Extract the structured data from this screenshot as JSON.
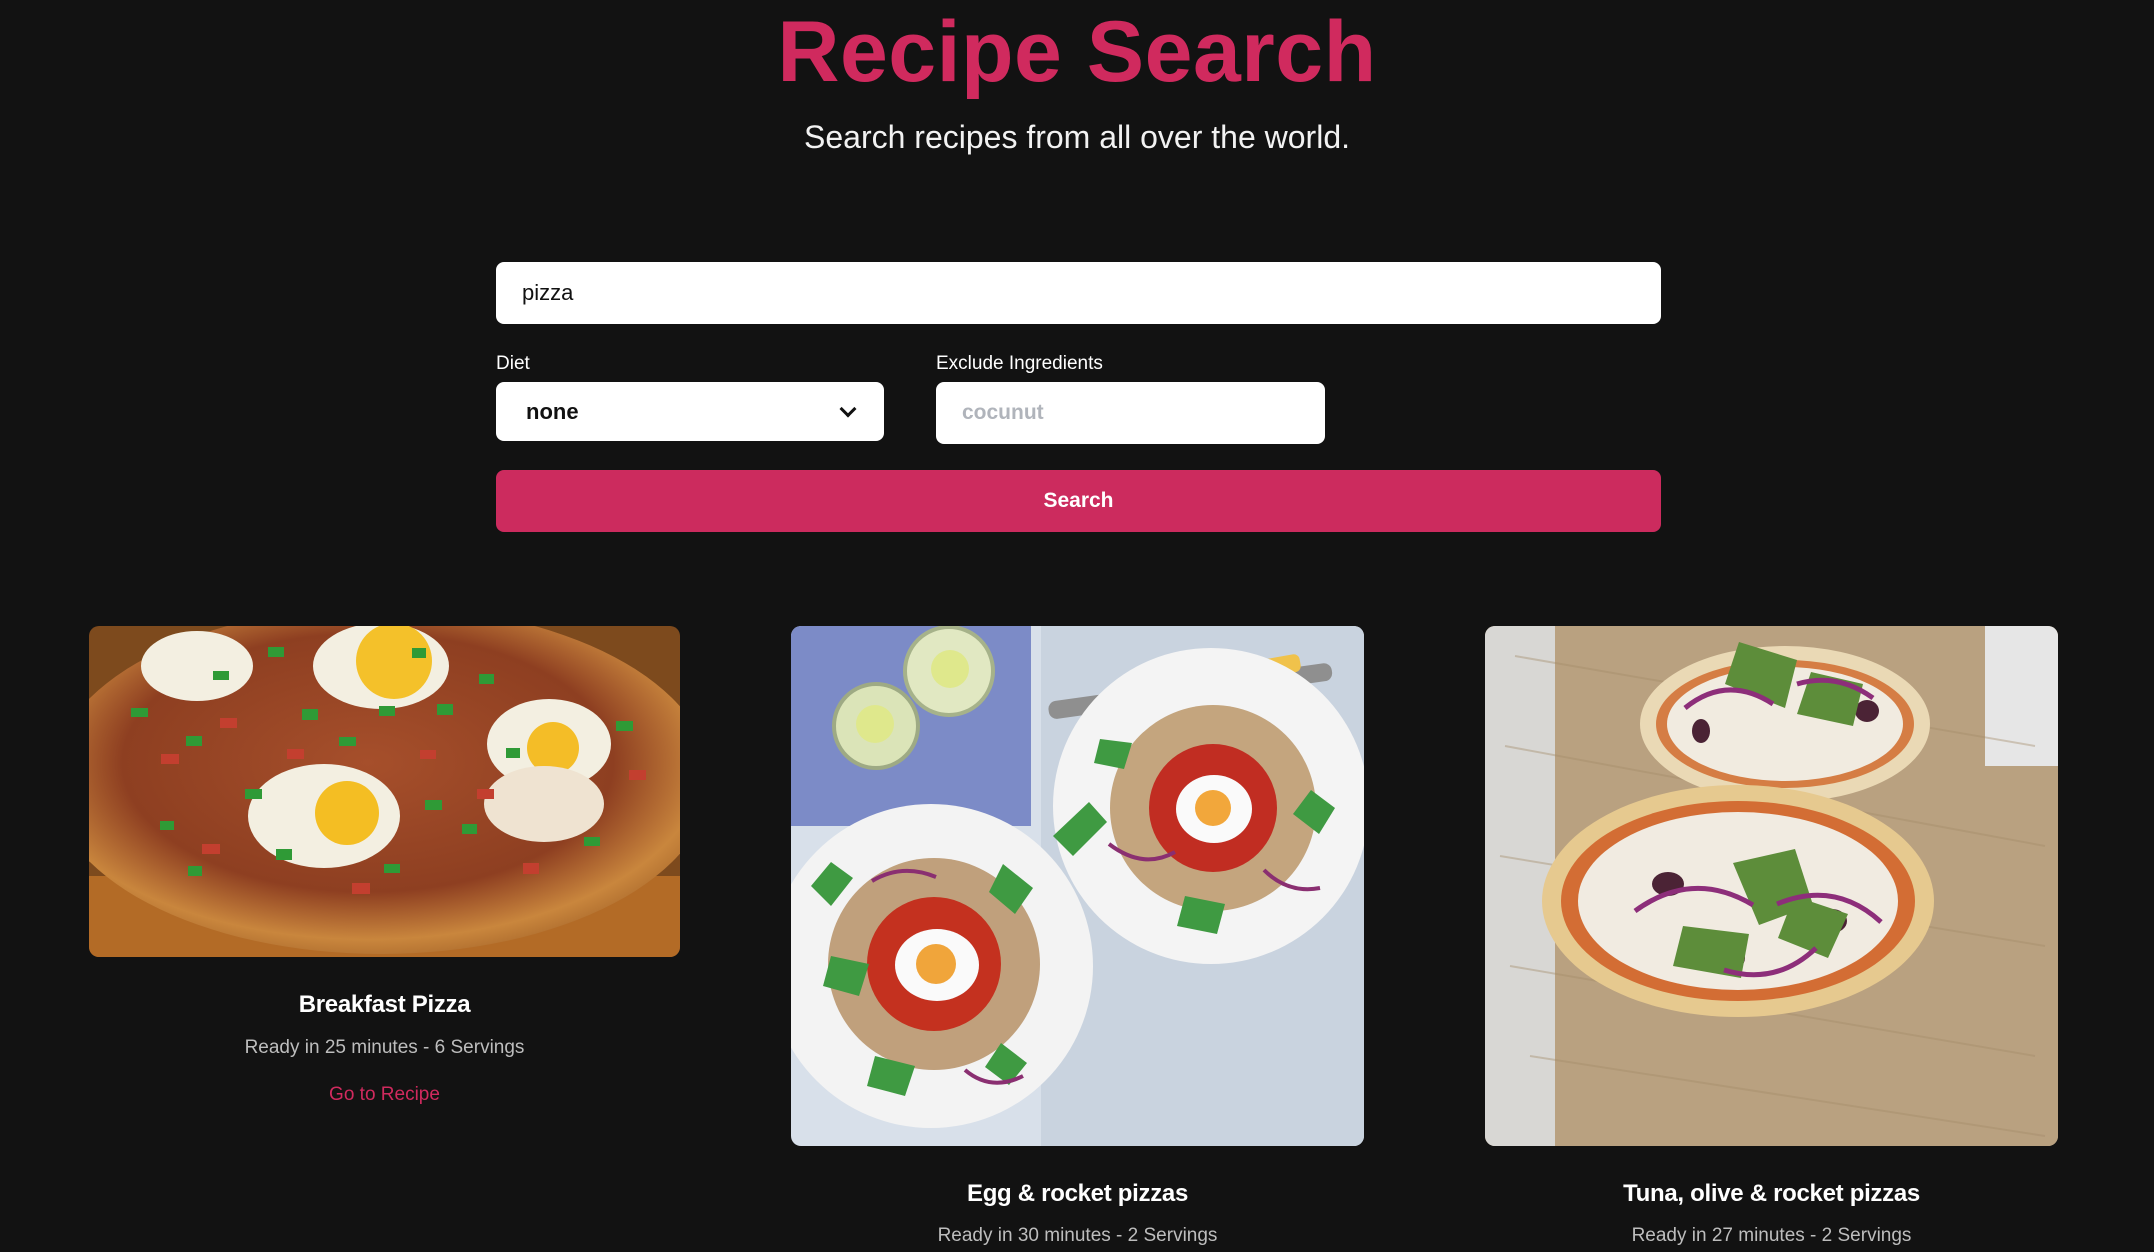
{
  "header": {
    "title": "Recipe Search",
    "subtitle": "Search recipes from all over the world."
  },
  "search": {
    "query_value": "pizza",
    "diet_label": "Diet",
    "diet_selected": "none",
    "exclude_label": "Exclude Ingredients",
    "exclude_placeholder": "cocunut",
    "button_label": "Search"
  },
  "recipes": [
    {
      "title": "Breakfast Pizza",
      "meta": "Ready in 25 minutes - 6 Servings",
      "link": "Go to Recipe"
    },
    {
      "title": "Egg & rocket pizzas",
      "meta": "Ready in 30 minutes - 2 Servings"
    },
    {
      "title": "Tuna, olive & rocket pizzas",
      "meta": "Ready in 27 minutes - 2 Servings"
    }
  ],
  "colors": {
    "accent": "#cc2b5e",
    "background": "#121212"
  }
}
